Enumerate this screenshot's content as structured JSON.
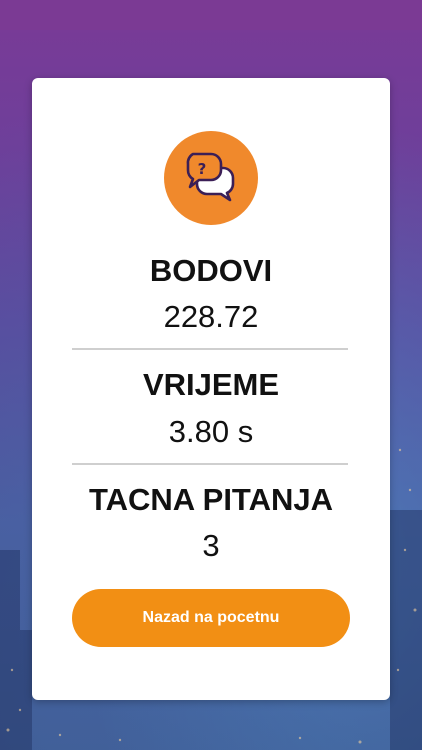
{
  "result": {
    "points": {
      "label": "BODOVI",
      "value": "228.72"
    },
    "time": {
      "label": "VRIJEME",
      "value": "3.80 s"
    },
    "correct": {
      "label": "TACNA PITANJA",
      "value": "3"
    }
  },
  "actions": {
    "home_label": "Nazad na pocetnu"
  },
  "icons": {
    "badge": "question-chat-icon"
  },
  "colors": {
    "accent": "#f28f14",
    "badge": "#f0892c",
    "background_top": "#7a3a96",
    "background_bottom": "#3e5890"
  }
}
